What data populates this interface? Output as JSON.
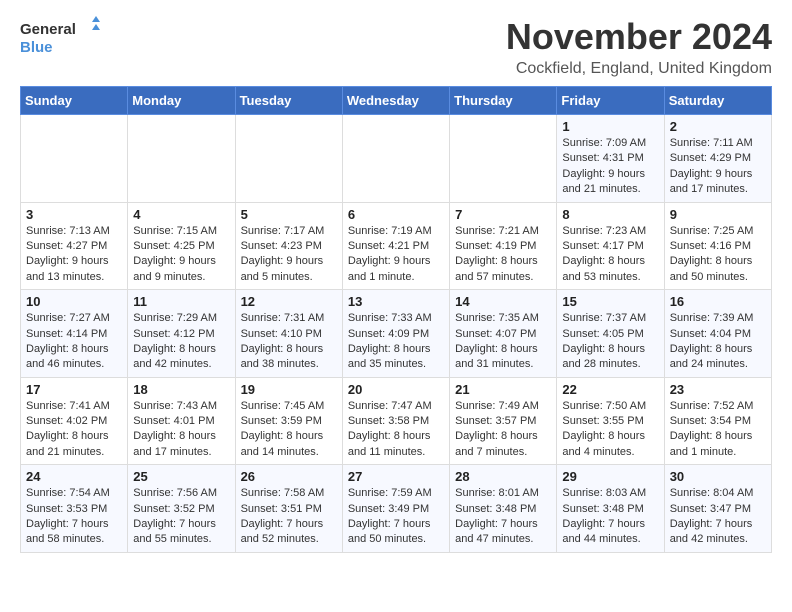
{
  "logo": {
    "line1": "General",
    "line2": "Blue"
  },
  "title": "November 2024",
  "location": "Cockfield, England, United Kingdom",
  "weekdays": [
    "Sunday",
    "Monday",
    "Tuesday",
    "Wednesday",
    "Thursday",
    "Friday",
    "Saturday"
  ],
  "weeks": [
    [
      {
        "day": "",
        "content": ""
      },
      {
        "day": "",
        "content": ""
      },
      {
        "day": "",
        "content": ""
      },
      {
        "day": "",
        "content": ""
      },
      {
        "day": "",
        "content": ""
      },
      {
        "day": "1",
        "content": "Sunrise: 7:09 AM\nSunset: 4:31 PM\nDaylight: 9 hours\nand 21 minutes."
      },
      {
        "day": "2",
        "content": "Sunrise: 7:11 AM\nSunset: 4:29 PM\nDaylight: 9 hours\nand 17 minutes."
      }
    ],
    [
      {
        "day": "3",
        "content": "Sunrise: 7:13 AM\nSunset: 4:27 PM\nDaylight: 9 hours\nand 13 minutes."
      },
      {
        "day": "4",
        "content": "Sunrise: 7:15 AM\nSunset: 4:25 PM\nDaylight: 9 hours\nand 9 minutes."
      },
      {
        "day": "5",
        "content": "Sunrise: 7:17 AM\nSunset: 4:23 PM\nDaylight: 9 hours\nand 5 minutes."
      },
      {
        "day": "6",
        "content": "Sunrise: 7:19 AM\nSunset: 4:21 PM\nDaylight: 9 hours\nand 1 minute."
      },
      {
        "day": "7",
        "content": "Sunrise: 7:21 AM\nSunset: 4:19 PM\nDaylight: 8 hours\nand 57 minutes."
      },
      {
        "day": "8",
        "content": "Sunrise: 7:23 AM\nSunset: 4:17 PM\nDaylight: 8 hours\nand 53 minutes."
      },
      {
        "day": "9",
        "content": "Sunrise: 7:25 AM\nSunset: 4:16 PM\nDaylight: 8 hours\nand 50 minutes."
      }
    ],
    [
      {
        "day": "10",
        "content": "Sunrise: 7:27 AM\nSunset: 4:14 PM\nDaylight: 8 hours\nand 46 minutes."
      },
      {
        "day": "11",
        "content": "Sunrise: 7:29 AM\nSunset: 4:12 PM\nDaylight: 8 hours\nand 42 minutes."
      },
      {
        "day": "12",
        "content": "Sunrise: 7:31 AM\nSunset: 4:10 PM\nDaylight: 8 hours\nand 38 minutes."
      },
      {
        "day": "13",
        "content": "Sunrise: 7:33 AM\nSunset: 4:09 PM\nDaylight: 8 hours\nand 35 minutes."
      },
      {
        "day": "14",
        "content": "Sunrise: 7:35 AM\nSunset: 4:07 PM\nDaylight: 8 hours\nand 31 minutes."
      },
      {
        "day": "15",
        "content": "Sunrise: 7:37 AM\nSunset: 4:05 PM\nDaylight: 8 hours\nand 28 minutes."
      },
      {
        "day": "16",
        "content": "Sunrise: 7:39 AM\nSunset: 4:04 PM\nDaylight: 8 hours\nand 24 minutes."
      }
    ],
    [
      {
        "day": "17",
        "content": "Sunrise: 7:41 AM\nSunset: 4:02 PM\nDaylight: 8 hours\nand 21 minutes."
      },
      {
        "day": "18",
        "content": "Sunrise: 7:43 AM\nSunset: 4:01 PM\nDaylight: 8 hours\nand 17 minutes."
      },
      {
        "day": "19",
        "content": "Sunrise: 7:45 AM\nSunset: 3:59 PM\nDaylight: 8 hours\nand 14 minutes."
      },
      {
        "day": "20",
        "content": "Sunrise: 7:47 AM\nSunset: 3:58 PM\nDaylight: 8 hours\nand 11 minutes."
      },
      {
        "day": "21",
        "content": "Sunrise: 7:49 AM\nSunset: 3:57 PM\nDaylight: 8 hours\nand 7 minutes."
      },
      {
        "day": "22",
        "content": "Sunrise: 7:50 AM\nSunset: 3:55 PM\nDaylight: 8 hours\nand 4 minutes."
      },
      {
        "day": "23",
        "content": "Sunrise: 7:52 AM\nSunset: 3:54 PM\nDaylight: 8 hours\nand 1 minute."
      }
    ],
    [
      {
        "day": "24",
        "content": "Sunrise: 7:54 AM\nSunset: 3:53 PM\nDaylight: 7 hours\nand 58 minutes."
      },
      {
        "day": "25",
        "content": "Sunrise: 7:56 AM\nSunset: 3:52 PM\nDaylight: 7 hours\nand 55 minutes."
      },
      {
        "day": "26",
        "content": "Sunrise: 7:58 AM\nSunset: 3:51 PM\nDaylight: 7 hours\nand 52 minutes."
      },
      {
        "day": "27",
        "content": "Sunrise: 7:59 AM\nSunset: 3:49 PM\nDaylight: 7 hours\nand 50 minutes."
      },
      {
        "day": "28",
        "content": "Sunrise: 8:01 AM\nSunset: 3:48 PM\nDaylight: 7 hours\nand 47 minutes."
      },
      {
        "day": "29",
        "content": "Sunrise: 8:03 AM\nSunset: 3:48 PM\nDaylight: 7 hours\nand 44 minutes."
      },
      {
        "day": "30",
        "content": "Sunrise: 8:04 AM\nSunset: 3:47 PM\nDaylight: 7 hours\nand 42 minutes."
      }
    ]
  ]
}
